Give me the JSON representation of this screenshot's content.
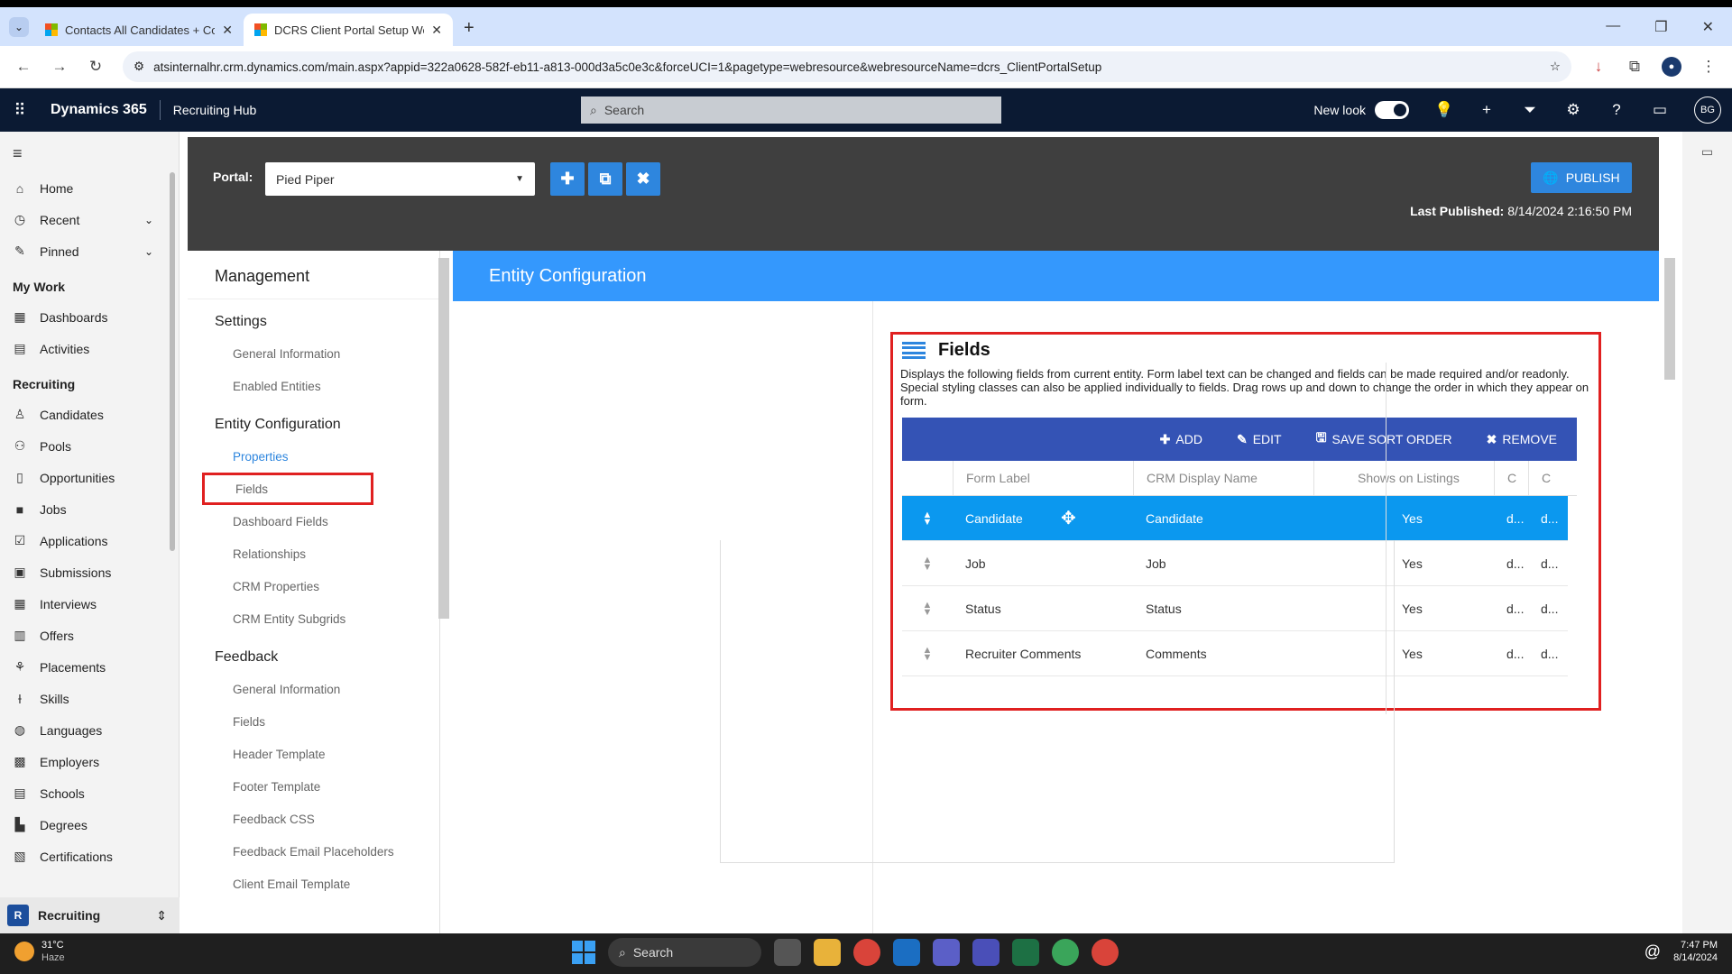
{
  "browser": {
    "tabs": [
      {
        "title": "Contacts All Candidates + Cont",
        "active": false
      },
      {
        "title": "DCRS Client Portal Setup Web R",
        "active": true
      }
    ],
    "url": "atsinternalhr.crm.dynamics.com/main.aspx?appid=322a0628-582f-eb11-a813-000d3a5c0e3c&forceUCI=1&pagetype=webresource&webresourceName=dcrs_ClientPortalSetup"
  },
  "d365": {
    "brand": "Dynamics 365",
    "app": "Recruiting Hub",
    "search_placeholder": "Search",
    "new_look_label": "New look",
    "user_initials": "BG"
  },
  "leftnav": {
    "top_items": [
      {
        "label": "Home",
        "icon": "home-icon"
      },
      {
        "label": "Recent",
        "icon": "clock-icon"
      },
      {
        "label": "Pinned",
        "icon": "pin-icon"
      }
    ],
    "my_work_label": "My Work",
    "my_work_items": [
      {
        "label": "Dashboards",
        "icon": "dashboard-icon"
      },
      {
        "label": "Activities",
        "icon": "activities-icon"
      }
    ],
    "recruiting_label": "Recruiting",
    "recruiting_items": [
      {
        "label": "Candidates",
        "icon": "person-icon"
      },
      {
        "label": "Pools",
        "icon": "pools-icon"
      },
      {
        "label": "Opportunities",
        "icon": "opportunities-icon"
      },
      {
        "label": "Jobs",
        "icon": "briefcase-icon"
      },
      {
        "label": "Applications",
        "icon": "applications-icon"
      },
      {
        "label": "Submissions",
        "icon": "submissions-icon"
      },
      {
        "label": "Interviews",
        "icon": "calendar-icon"
      },
      {
        "label": "Offers",
        "icon": "offers-icon"
      },
      {
        "label": "Placements",
        "icon": "placements-icon"
      },
      {
        "label": "Skills",
        "icon": "skills-icon"
      },
      {
        "label": "Languages",
        "icon": "globe-icon"
      },
      {
        "label": "Employers",
        "icon": "building-icon"
      },
      {
        "label": "Schools",
        "icon": "schools-icon"
      },
      {
        "label": "Degrees",
        "icon": "degrees-icon"
      },
      {
        "label": "Certifications",
        "icon": "certificate-icon"
      }
    ],
    "area_switcher": {
      "badge": "R",
      "label": "Recruiting"
    }
  },
  "portal": {
    "label": "Portal:",
    "selected": "Pied Piper",
    "publish_label": "PUBLISH",
    "last_published_label": "Last Published:",
    "last_published_value": "8/14/2024 2:16:50 PM"
  },
  "management": {
    "title": "Management",
    "sections": [
      {
        "title": "Settings",
        "links": [
          "General Information",
          "Enabled Entities"
        ]
      },
      {
        "title": "Entity Configuration",
        "links": [
          "Properties",
          "Fields",
          "Dashboard Fields",
          "Relationships",
          "CRM Properties",
          "CRM Entity Subgrids"
        ]
      },
      {
        "title": "Feedback",
        "links": [
          "General Information",
          "Fields",
          "Header Template",
          "Footer Template",
          "Feedback CSS",
          "Feedback Email Placeholders",
          "Client Email Template"
        ]
      }
    ]
  },
  "entity_config": {
    "header": "Entity Configuration",
    "fields_title": "Fields",
    "fields_desc": "Displays the following fields from current entity. Form label text can be changed and fields can be made required and/or readonly. Special styling classes can also be applied individually to fields. Drag rows up and down to change the order in which they appear on form.",
    "toolbar": {
      "add": "ADD",
      "edit": "EDIT",
      "save_sort": "SAVE SORT ORDER",
      "remove": "REMOVE"
    },
    "columns": [
      "Form Label",
      "CRM Display Name",
      "Shows on Listings",
      "C",
      "C"
    ],
    "rows": [
      {
        "form_label": "Candidate",
        "crm_name": "Candidate",
        "listing": "Yes",
        "c1": "d...",
        "c2": "d...",
        "selected": true
      },
      {
        "form_label": "Job",
        "crm_name": "Job",
        "listing": "Yes",
        "c1": "d...",
        "c2": "d...",
        "selected": false
      },
      {
        "form_label": "Status",
        "crm_name": "Status",
        "listing": "Yes",
        "c1": "d...",
        "c2": "d...",
        "selected": false
      },
      {
        "form_label": "Recruiter Comments",
        "crm_name": "Comments",
        "listing": "Yes",
        "c1": "d...",
        "c2": "d...",
        "selected": false
      }
    ]
  },
  "taskbar": {
    "weather_temp": "31°C",
    "weather_desc": "Haze",
    "search_label": "Search",
    "time": "7:47 PM",
    "date": "8/14/2024"
  },
  "colors": {
    "accent": "#2e86de",
    "header_blue": "#3498fd",
    "grid_toolbar": "#3453b5",
    "selected_row": "#0b98ef",
    "highlight_red": "#e02020",
    "d365_header": "#0b1a33"
  }
}
